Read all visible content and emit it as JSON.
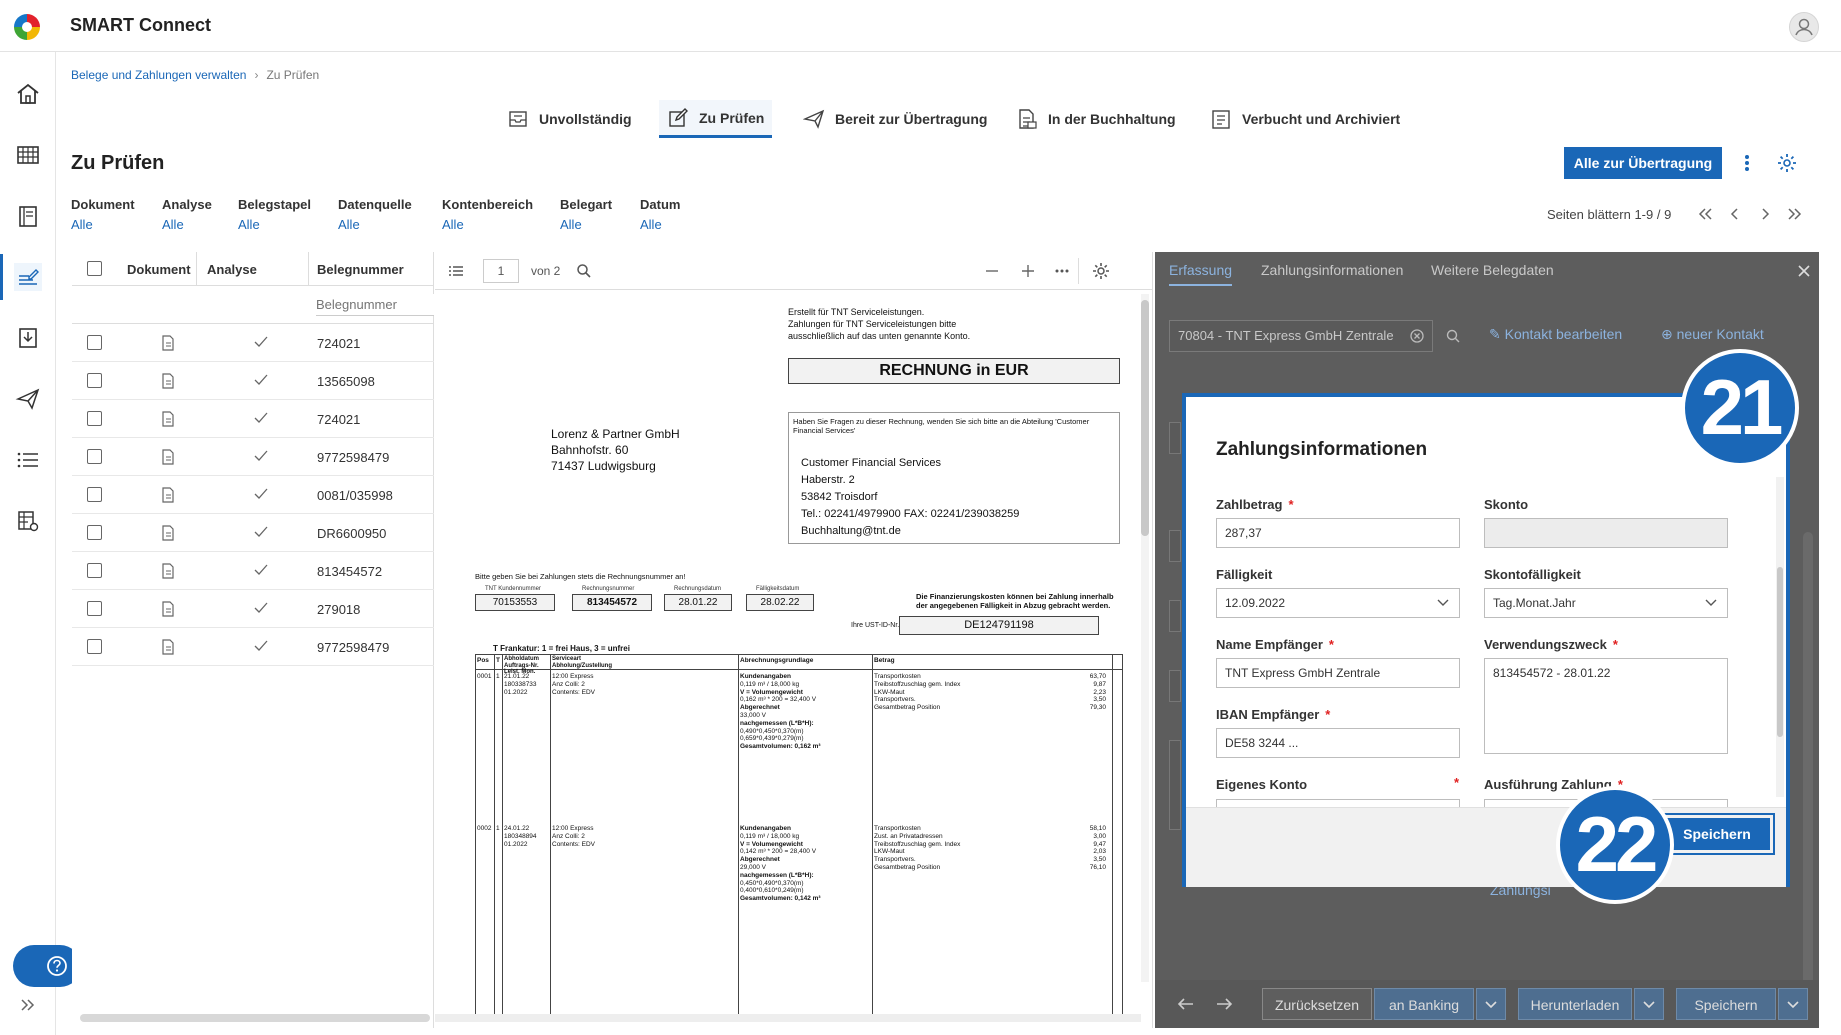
{
  "app": {
    "title": "SMART Connect"
  },
  "breadcrumb": {
    "parent": "Belege und Zahlungen verwalten",
    "current": "Zu Prüfen"
  },
  "tabs": [
    {
      "label": "Unvollständig"
    },
    {
      "label": "Zu Prüfen"
    },
    {
      "label": "Bereit zur Übertragung"
    },
    {
      "label": "In der Buchhaltung"
    },
    {
      "label": "Verbucht und Archiviert"
    }
  ],
  "page": {
    "title": "Zu Prüfen",
    "primary_button": "Alle zur Übertragung"
  },
  "filters": [
    {
      "label": "Dokument",
      "value": "Alle"
    },
    {
      "label": "Analyse",
      "value": "Alle"
    },
    {
      "label": "Belegstapel",
      "value": "Alle"
    },
    {
      "label": "Datenquelle",
      "value": "Alle"
    },
    {
      "label": "Kontenbereich",
      "value": "Alle"
    },
    {
      "label": "Belegart",
      "value": "Alle"
    },
    {
      "label": "Datum",
      "value": "Alle"
    }
  ],
  "pager": {
    "text": "Seiten blättern 1-9 / 9"
  },
  "list": {
    "headers": {
      "dokument": "Dokument",
      "analyse": "Analyse",
      "belegnummer": "Belegnummer"
    },
    "filter_placeholder": "Belegnummer",
    "rows": [
      "724021",
      "13565098",
      "724021",
      "9772598479",
      "0081/035998",
      "DR6600950",
      "813454572",
      "279018",
      "9772598479"
    ]
  },
  "viewer": {
    "page_input": "1",
    "page_total": "von 2"
  },
  "invoice": {
    "sender_note": [
      "Erstellt für TNT Serviceleistungen.",
      "Zahlungen für TNT Serviceleistungen bitte",
      "ausschließlich auf das unten genannte Konto."
    ],
    "heading": "RECHNUNG in EUR",
    "recipient": [
      "Lorenz & Partner GmbH",
      "Bahnhofstr. 60",
      "71437 Ludwigsburg"
    ],
    "contact_note": "Haben Sie Fragen zu dieser Rechnung, wenden Sie sich bitte an die Abteilung 'Customer Financial Services'",
    "contact": [
      "Customer Financial Services",
      "Haberstr. 2",
      "53842   Troisdorf",
      "Tel.: 02241/4979900 FAX: 02241/239038259",
      "Buchhaltung@tnt.de"
    ],
    "ref_note": "Bitte geben Sie bei Zahlungen stets die Rechnungsnummer an!",
    "fields": [
      {
        "label": "TNT Kundennummer",
        "value": "70153553"
      },
      {
        "label": "Rechnungsnummer",
        "value": "813454572"
      },
      {
        "label": "Rechnungsdatum",
        "value": "28.01.22"
      },
      {
        "label": "Fälligkeitsdatum",
        "value": "28.02.22"
      }
    ],
    "finance_note": "Die Finanzierungskosten können bei Zahlung innerhalb der angegebenen Fälligkeit in Abzug gebracht werden.",
    "vat_label": "Ihre UST-ID-Nr.",
    "vat_value": "DE124791198",
    "frankatur": "T  Frankatur: 1 = frei Haus, 3 = unfrei",
    "table_headers": [
      "Pos",
      "T",
      "Abholdatum Auftrags-Nr. Leist. Mon.",
      "Serviceart Abholung/Zustellung",
      "Abrechnungsgrundlage",
      "Betrag"
    ],
    "items": [
      {
        "pos": "0001",
        "t": "1",
        "dates": [
          "21.01.22",
          "180338733",
          "01.2022"
        ],
        "service": [
          "12:00 Express",
          "Anz Colli:     2",
          "Contents:     EDV"
        ],
        "basis": [
          "Kundenangaben",
          "0,119 m³  / 18,000 kg",
          "V = Volumengewicht",
          "0,162 m³  * 200  = 32,400 V",
          "Abgerechnet",
          "33,000 V",
          "nachgemessen (L*B*H):",
          "0,490*0,450*0,370(m)",
          "0,659*0,439*0,279(m)",
          "Gesamtvolumen: 0,162 m³"
        ],
        "desc": [
          "Transportkosten",
          "Treibstoffzuschlag gem. Index",
          "LKW-Maut",
          "Transportvers.",
          "Gesamtbetrag Position"
        ],
        "amounts": [
          "63,70",
          "9,87",
          "2,23",
          "3,50",
          "79,30"
        ]
      },
      {
        "pos": "0002",
        "t": "1",
        "dates": [
          "24.01.22",
          "180348894",
          "01.2022"
        ],
        "service": [
          "12:00 Express",
          "Anz Colli:     2",
          "Contents:     EDV"
        ],
        "basis": [
          "Kundenangaben",
          "0,119 m³  / 18,000 kg",
          "V = Volumengewicht",
          "0,142 m³  * 200  = 28,400 V",
          "Abgerechnet",
          "29,000 V",
          "nachgemessen (L*B*H):",
          "0,450*0,490*0,370(m)",
          "0,400*0,610*0,249(m)",
          "Gesamtvolumen: 0,142 m³"
        ],
        "desc": [
          "Transportkosten",
          "Zust. an Privatadressen",
          "Treibstoffzuschlag gem. Index",
          "LKW-Maut",
          "Transportvers.",
          "Gesamtbetrag Position"
        ],
        "amounts": [
          "58,10",
          "3,00",
          "9,47",
          "2,03",
          "3,50",
          "76,10"
        ]
      }
    ]
  },
  "right": {
    "tabs": [
      "Erfassung",
      "Zahlungsinformationen",
      "Weitere Belegdaten"
    ],
    "contact_value": "70804 - TNT Express GmbH Zentrale",
    "edit_contact": "Kontakt bearbeiten",
    "new_contact": "neuer Kontakt",
    "behind_link": "Zahlungsi",
    "bottom": {
      "reset": "Zurücksetzen",
      "banking": "an Banking",
      "download": "Herunterladen",
      "save": "Speichern"
    }
  },
  "modal": {
    "title": "Zahlungsinformationen",
    "zahlbetrag": {
      "label": "Zahlbetrag",
      "value": "287,37"
    },
    "skonto": {
      "label": "Skonto",
      "value": ""
    },
    "faelligkeit": {
      "label": "Fälligkeit",
      "value": "12.09.2022"
    },
    "skontofaelligkeit": {
      "label": "Skontofälligkeit",
      "value": "Tag.Monat.Jahr"
    },
    "empfaenger": {
      "label": "Name Empfänger",
      "value": "TNT Express GmbH Zentrale"
    },
    "verwendungszweck": {
      "label": "Verwendungszweck",
      "value": "813454572 - 28.01.22"
    },
    "iban": {
      "label": "IBAN Empfänger",
      "value": "DE58 3244 ..."
    },
    "eigenes_konto": {
      "label": "Eigenes Konto"
    },
    "ausfuehrung": {
      "label": "Ausführung Zahlung"
    },
    "save": "Speichern",
    "required_mark": "*"
  },
  "badges": {
    "b21": "21",
    "b22": "22"
  },
  "colors": {
    "accent": "#1a67b7",
    "overlay": "#5d5d5d",
    "required": "#e02020"
  }
}
